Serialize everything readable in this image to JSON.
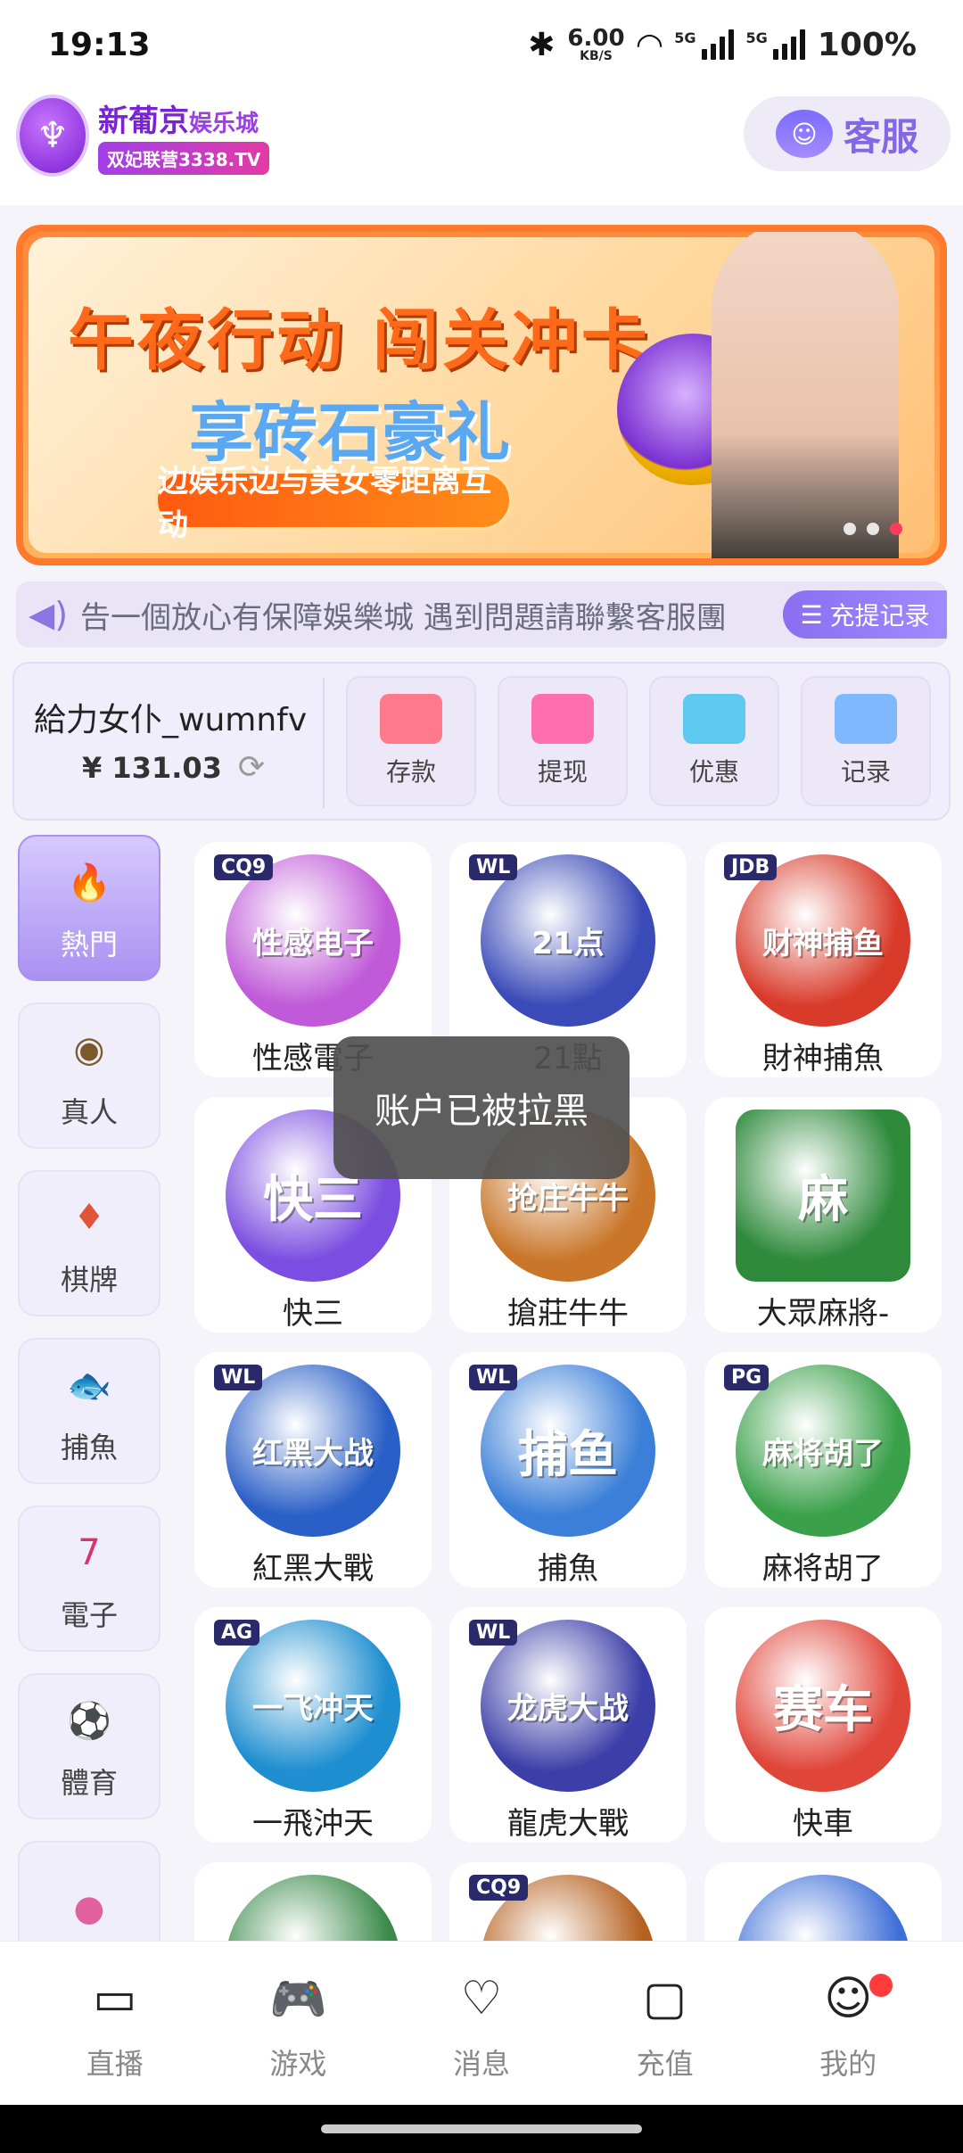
{
  "status_bar": {
    "time": "19:13",
    "speed_value": "6.00",
    "speed_unit": "KB/S",
    "net1": "5G",
    "net2": "5G",
    "battery": "100%"
  },
  "header": {
    "logo_title": "新葡京",
    "logo_title_suffix": "娱乐城",
    "logo_subtitle": "双妃联营3338.TV",
    "service_label": "客服"
  },
  "banner": {
    "headline": "午夜行动 闯关冲卡",
    "subline": "享砖石豪礼",
    "pill": "边娱乐边与美女零距离互动",
    "slide_count": 3,
    "active_slide": 3
  },
  "notice": {
    "text": "告一個放心有保障娛樂城  遇到問題請聯繫客服團",
    "record_button": "充提记录"
  },
  "wallet": {
    "username": "給力女仆_wumnfv",
    "balance": "¥ 131.03",
    "actions": [
      {
        "label": "存款",
        "icon": "deposit-card-icon",
        "color": "#ff7a8a"
      },
      {
        "label": "提现",
        "icon": "money-bag-icon",
        "color": "#ff6fb0"
      },
      {
        "label": "优惠",
        "icon": "gift-icon",
        "color": "#5ec9f0"
      },
      {
        "label": "记录",
        "icon": "bar-chart-icon",
        "color": "#7fb8ff"
      }
    ]
  },
  "categories": [
    {
      "label": "熱門",
      "icon": "flame-icon",
      "active": true
    },
    {
      "label": "真人",
      "icon": "casino-chip-icon",
      "active": false
    },
    {
      "label": "棋牌",
      "icon": "playing-card-icon",
      "active": false
    },
    {
      "label": "捕魚",
      "icon": "fish-icon",
      "active": false
    },
    {
      "label": "電子",
      "icon": "slot-machine-icon",
      "active": false
    },
    {
      "label": "體育",
      "icon": "soccer-ball-icon",
      "active": false
    },
    {
      "label": "",
      "icon": "lottery-ball-icon",
      "active": false
    }
  ],
  "games": [
    {
      "name": "性感電子",
      "badge": "CQ9",
      "art": "性感电子",
      "color": "#c05ad8"
    },
    {
      "name": "21點",
      "badge": "WL",
      "art": "21点",
      "color": "#3a4bb8"
    },
    {
      "name": "財神捕魚",
      "badge": "JDB",
      "art": "财神捕鱼",
      "color": "#d93b2b"
    },
    {
      "name": "快三",
      "badge": "",
      "art": "快三",
      "color": "#7b4de0"
    },
    {
      "name": "搶莊牛牛",
      "badge": "",
      "art": "抢庄牛牛",
      "color": "#c9762a"
    },
    {
      "name": "大眾麻將-",
      "badge": "",
      "art": "麻",
      "color": "#2f8a3c"
    },
    {
      "name": "紅黑大戰",
      "badge": "WL",
      "art": "红黑大战",
      "color": "#2a5fc7"
    },
    {
      "name": "捕魚",
      "badge": "WL",
      "art": "捕鱼",
      "color": "#3b7fd8"
    },
    {
      "name": "麻将胡了",
      "badge": "PG",
      "art": "麻将胡了",
      "color": "#3aa04a"
    },
    {
      "name": "一飛沖天",
      "badge": "AG",
      "art": "一飞冲天",
      "color": "#1e8ed0"
    },
    {
      "name": "龍虎大戰",
      "badge": "WL",
      "art": "龙虎大战",
      "color": "#3d3fa8"
    },
    {
      "name": "快車",
      "badge": "",
      "art": "赛车",
      "color": "#e0453a"
    },
    {
      "name": "",
      "badge": "",
      "art": "",
      "color": "#3b8a4a"
    },
    {
      "name": "",
      "badge": "CQ9",
      "art": "",
      "color": "#b5601f"
    },
    {
      "name": "",
      "badge": "",
      "art": "",
      "color": "#3f6fd8"
    }
  ],
  "toast": "账户已被拉黑",
  "bottom_nav": [
    {
      "label": "直播",
      "icon": "video-camera-icon"
    },
    {
      "label": "游戏",
      "icon": "gamepad-icon"
    },
    {
      "label": "消息",
      "icon": "chat-heart-icon"
    },
    {
      "label": "充值",
      "icon": "wallet-icon"
    },
    {
      "label": "我的",
      "icon": "smiley-profile-icon",
      "badge": true
    }
  ]
}
